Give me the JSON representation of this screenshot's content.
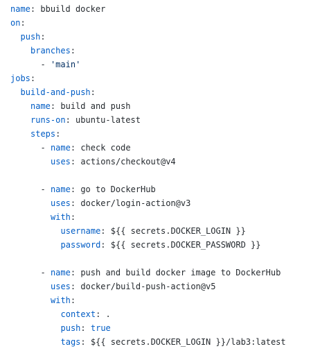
{
  "colors": {
    "background": "#ffffff",
    "key": "#005cc5",
    "string": "#032f62",
    "text": "#24292e"
  },
  "lines": [
    {
      "indent": 0,
      "dash": false,
      "key": "name",
      "value": "bbuild docker",
      "type": "plain"
    },
    {
      "indent": 0,
      "dash": false,
      "key": "on",
      "value": "",
      "type": "plain"
    },
    {
      "indent": 1,
      "dash": false,
      "key": "push",
      "value": "",
      "type": "plain"
    },
    {
      "indent": 2,
      "dash": false,
      "key": "branches",
      "value": "",
      "type": "plain"
    },
    {
      "indent": 3,
      "dash": true,
      "key": "",
      "value": "'main'",
      "type": "string"
    },
    {
      "indent": 0,
      "dash": false,
      "key": "jobs",
      "value": "",
      "type": "plain"
    },
    {
      "indent": 1,
      "dash": false,
      "key": "build-and-push",
      "value": "",
      "type": "plain"
    },
    {
      "indent": 2,
      "dash": false,
      "key": "name",
      "value": "build and push",
      "type": "plain"
    },
    {
      "indent": 2,
      "dash": false,
      "key": "runs-on",
      "value": "ubuntu-latest",
      "type": "plain"
    },
    {
      "indent": 2,
      "dash": false,
      "key": "steps",
      "value": "",
      "type": "plain"
    },
    {
      "indent": 3,
      "dash": true,
      "key": "name",
      "value": "check code",
      "type": "plain"
    },
    {
      "indent": 4,
      "dash": false,
      "key": "uses",
      "value": "actions/checkout@v4",
      "type": "plain"
    },
    {
      "indent": 0,
      "dash": false,
      "key": "",
      "value": "",
      "type": "blank"
    },
    {
      "indent": 3,
      "dash": true,
      "key": "name",
      "value": "go to DockerHub",
      "type": "plain"
    },
    {
      "indent": 4,
      "dash": false,
      "key": "uses",
      "value": "docker/login-action@v3",
      "type": "plain"
    },
    {
      "indent": 4,
      "dash": false,
      "key": "with",
      "value": "",
      "type": "plain"
    },
    {
      "indent": 5,
      "dash": false,
      "key": "username",
      "value": "${{ secrets.DOCKER_LOGIN }}",
      "type": "plain"
    },
    {
      "indent": 5,
      "dash": false,
      "key": "password",
      "value": "${{ secrets.DOCKER_PASSWORD }}",
      "type": "plain"
    },
    {
      "indent": 0,
      "dash": false,
      "key": "",
      "value": "",
      "type": "blank"
    },
    {
      "indent": 3,
      "dash": true,
      "key": "name",
      "value": "push and build docker image to DockerHub",
      "type": "plain"
    },
    {
      "indent": 4,
      "dash": false,
      "key": "uses",
      "value": "docker/build-push-action@v5",
      "type": "plain"
    },
    {
      "indent": 4,
      "dash": false,
      "key": "with",
      "value": "",
      "type": "plain"
    },
    {
      "indent": 5,
      "dash": false,
      "key": "context",
      "value": ".",
      "type": "plain"
    },
    {
      "indent": 5,
      "dash": false,
      "key": "push",
      "value": "true",
      "type": "keyword"
    },
    {
      "indent": 5,
      "dash": false,
      "key": "tags",
      "value": "${{ secrets.DOCKER_LOGIN }}/lab3:latest",
      "type": "plain"
    }
  ]
}
